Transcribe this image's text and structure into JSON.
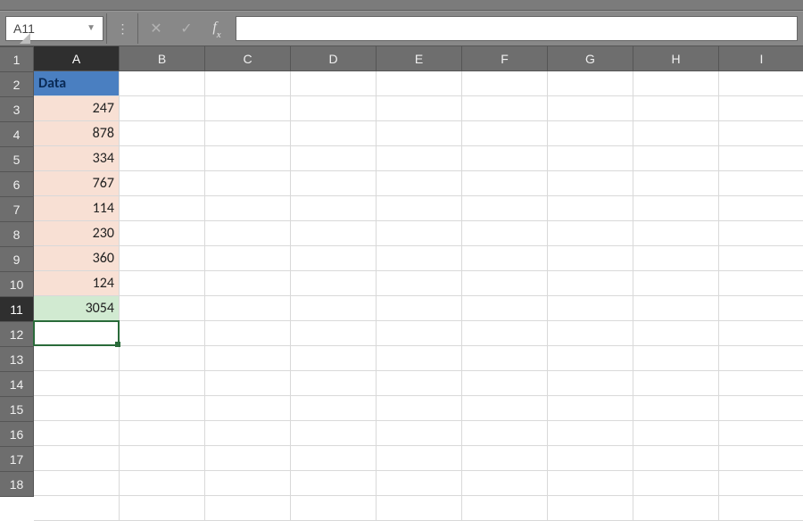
{
  "name_box": {
    "value": "A11"
  },
  "formula_bar": {
    "value": ""
  },
  "columns": [
    "A",
    "B",
    "C",
    "D",
    "E",
    "F",
    "G",
    "H",
    "I"
  ],
  "selected_column_index": 0,
  "rows": [
    "1",
    "2",
    "3",
    "4",
    "5",
    "6",
    "7",
    "8",
    "9",
    "10",
    "11",
    "12",
    "13",
    "14",
    "15",
    "16",
    "17",
    "18"
  ],
  "selected_row_index": 10,
  "cells": {
    "A1": "Data",
    "A2": "247",
    "A3": "878",
    "A4": "334",
    "A5": "767",
    "A6": "114",
    "A7": "230",
    "A8": "360",
    "A9": "124",
    "A10": "3054"
  },
  "active_cell": "A11",
  "icons": {
    "cancel": "✕",
    "accept": "✓",
    "fx": "f",
    "fx_sub": "x"
  }
}
